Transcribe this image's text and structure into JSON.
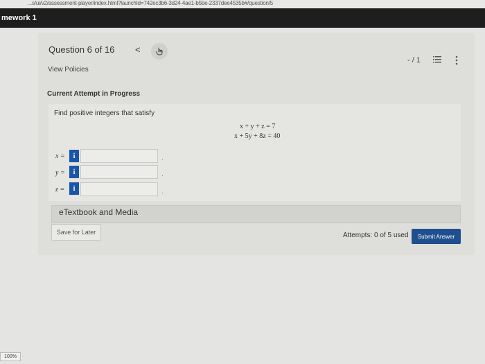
{
  "browser": {
    "url": "...s/ui/v2/assessment-player/index.html?launchId=742ec3b6-3d24-4ae1-b5be-2337dee4535b#/question/5"
  },
  "header": {
    "course_title": "mework 1"
  },
  "question_nav": {
    "title": "Question 6 of 16",
    "prev_symbol": "<",
    "next_icon": "cursor-hand-icon"
  },
  "links": {
    "view_policies": "View Policies"
  },
  "score": {
    "text": "- / 1"
  },
  "icons": {
    "list": "list-icon",
    "more": "more-vertical-icon",
    "info": "info-icon"
  },
  "attempt": {
    "title": "Current Attempt in Progress"
  },
  "question": {
    "prompt": "Find positive integers that satisfy",
    "equations": [
      "x + y + z = 7",
      "x + 5y + 8z = 40"
    ],
    "answers": [
      {
        "label": "x =",
        "info": "i",
        "value": "",
        "suffix": "."
      },
      {
        "label": "y =",
        "info": "i",
        "value": "",
        "suffix": "."
      },
      {
        "label": "z =",
        "info": "i",
        "value": "",
        "suffix": "."
      }
    ]
  },
  "etextbook": {
    "label": "eTextbook and Media"
  },
  "footer": {
    "save_label": "Save for Later",
    "attempts_text": "Attempts: 0 of 5 used",
    "submit_label": "Submit Answer"
  },
  "status": {
    "zoom": "100%"
  },
  "colors": {
    "topbar": "#1e1e1e",
    "info_button": "#1a56a8",
    "submit_button": "#1f4f8f"
  }
}
